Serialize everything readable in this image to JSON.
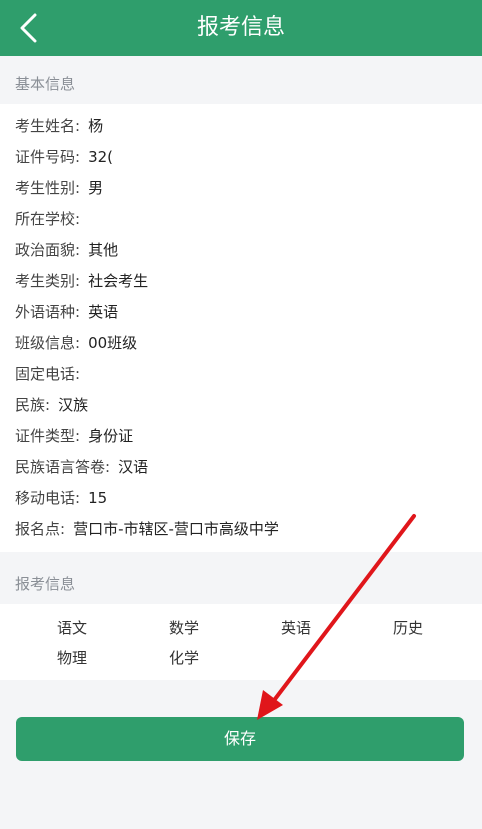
{
  "header": {
    "title": "报考信息"
  },
  "basic": {
    "section_title": "基本信息",
    "fields": [
      {
        "label": "考生姓名:",
        "value": "杨"
      },
      {
        "label": "证件号码:",
        "value": "32("
      },
      {
        "label": "考生性别:",
        "value": "男"
      },
      {
        "label": "所在学校:",
        "value": ""
      },
      {
        "label": "政治面貌:",
        "value": "其他"
      },
      {
        "label": "考生类别:",
        "value": "社会考生"
      },
      {
        "label": "外语语种:",
        "value": "英语"
      },
      {
        "label": "班级信息:",
        "value": "00班级"
      },
      {
        "label": "固定电话:",
        "value": ""
      },
      {
        "label": "民族:",
        "value": "汉族"
      },
      {
        "label": "证件类型:",
        "value": "身份证"
      },
      {
        "label": "民族语言答卷:",
        "value": "汉语"
      },
      {
        "label": "移动电话:",
        "value": "15"
      },
      {
        "label": "报名点:",
        "value": "营口市-市辖区-营口市高级中学"
      }
    ]
  },
  "exam": {
    "section_title": "报考信息",
    "subjects": [
      "语文",
      "数学",
      "英语",
      "历史",
      "物理",
      "化学"
    ]
  },
  "footer": {
    "save_label": "保存"
  },
  "colors": {
    "accent": "#2f9e6c",
    "annotation_arrow": "#e0161b"
  }
}
